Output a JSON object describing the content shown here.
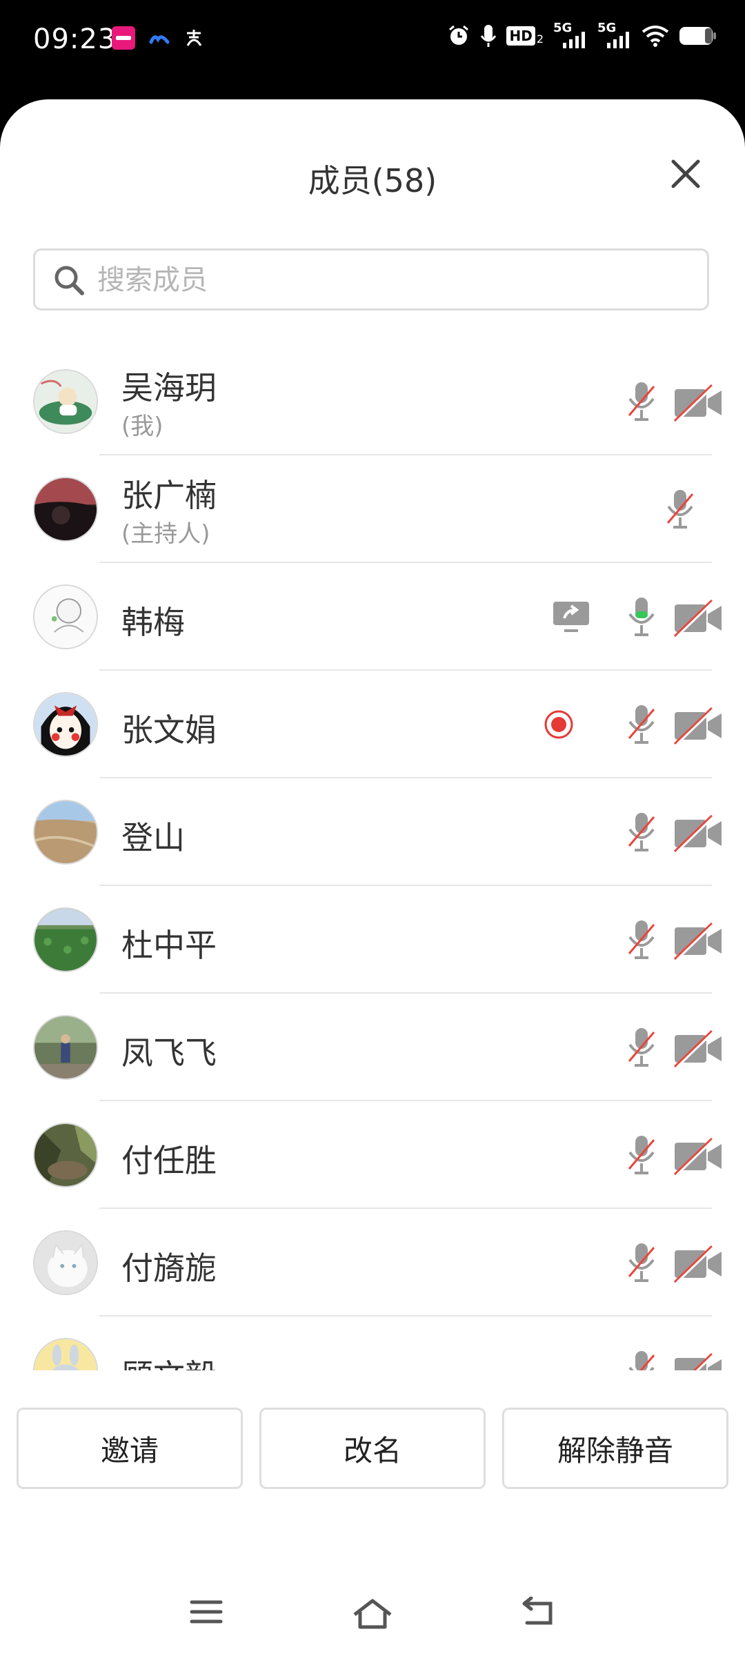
{
  "status_bar": {
    "time": "09:23",
    "left_icons": [
      "app-badge-icon",
      "cloud-icon",
      "alipay-icon"
    ],
    "right_icons": [
      "alarm-icon",
      "mic-icon",
      "hd-icon",
      "signal-5g-1-icon",
      "signal-5g-2-icon",
      "wifi-icon",
      "battery-icon"
    ],
    "hd_text": "HD",
    "hd_sub": "2",
    "net1": "5G",
    "net2": "5G"
  },
  "header": {
    "title": "成员(58)",
    "close_icon": "close-icon"
  },
  "search": {
    "placeholder": "搜索成员"
  },
  "members": [
    {
      "name": "吴海玥",
      "sub": "(我)",
      "mic": "muted",
      "cam": "off",
      "extra": ""
    },
    {
      "name": "张广楠",
      "sub": "(主持人)",
      "mic": "muted",
      "cam": "",
      "extra": ""
    },
    {
      "name": "韩梅",
      "sub": "",
      "mic": "active",
      "cam": "off",
      "extra": "screen-share"
    },
    {
      "name": "张文娟",
      "sub": "",
      "mic": "muted",
      "cam": "off",
      "extra": "recording"
    },
    {
      "name": "登山",
      "sub": "",
      "mic": "muted",
      "cam": "off",
      "extra": ""
    },
    {
      "name": "杜中平",
      "sub": "",
      "mic": "muted",
      "cam": "off",
      "extra": ""
    },
    {
      "name": "凤飞飞",
      "sub": "",
      "mic": "muted",
      "cam": "off",
      "extra": ""
    },
    {
      "name": "付任胜",
      "sub": "",
      "mic": "muted",
      "cam": "off",
      "extra": ""
    },
    {
      "name": "付旖旎",
      "sub": "",
      "mic": "muted",
      "cam": "off",
      "extra": ""
    },
    {
      "name": "顾文毅",
      "sub": "",
      "mic": "muted",
      "cam": "off",
      "extra": ""
    }
  ],
  "footer": {
    "invite": "邀请",
    "rename": "改名",
    "unmute": "解除静音"
  },
  "colors": {
    "muted_slash": "#e8453c",
    "mic_active": "#35c759",
    "record_red": "#e53935",
    "icon_gray": "#9a9a9a"
  },
  "nav": [
    "menu-icon",
    "home-icon",
    "back-icon"
  ]
}
